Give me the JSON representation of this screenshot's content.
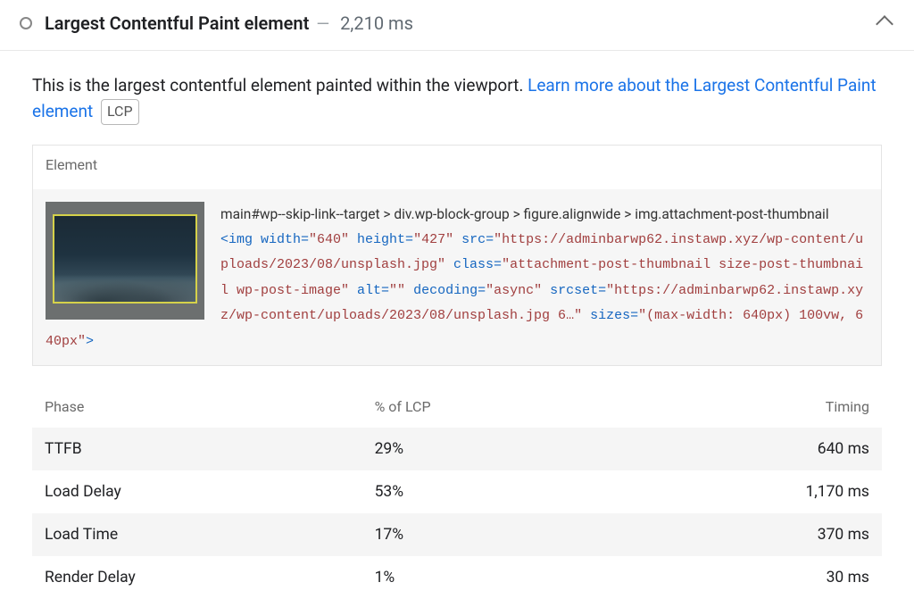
{
  "header": {
    "title": "Largest Contentful Paint element",
    "separator": "—",
    "timing": "2,210 ms"
  },
  "description": {
    "lead": "This is the largest contentful element painted within the viewport. ",
    "link_text": "Learn more about the Largest Contentful Paint element",
    "badge": "LCP"
  },
  "element_card": {
    "header": "Element",
    "selector_path": "main#wp--skip-link--target > div.wp-block-group > figure.alignwide > img.attachment-post-thumbnail",
    "html_snippet_prefix": "<img width=",
    "w": "\"640\"",
    "h_label": " height=",
    "h": "\"427\"",
    "src_label": " src=",
    "src": "\"https://adminbarwp62.instawp.xyz/wp-content/uploads/2023/08/unsplash.jpg\"",
    "class_label": " class=",
    "class": "\"attachment-post-thumbnail size-post-thumbnail wp-post-image\"",
    "alt_label": " alt=",
    "alt": "\"\"",
    "decoding_label": " decoding=",
    "decoding": "\"async\"",
    "srcset_label": " srcset=",
    "srcset": "\"https://adminbarwp62.instawp.xyz/wp-content/uploads/2023/08/unsplash.jpg 6…\"",
    "sizes_label": " sizes=",
    "sizes": "\"(max-width: 640px) 100vw, 640px\"",
    "close": ">"
  },
  "phase_table": {
    "head": {
      "phase": "Phase",
      "pct": "% of LCP",
      "timing": "Timing"
    },
    "rows": [
      {
        "phase": "TTFB",
        "pct": "29%",
        "timing": "640 ms"
      },
      {
        "phase": "Load Delay",
        "pct": "53%",
        "timing": "1,170 ms"
      },
      {
        "phase": "Load Time",
        "pct": "17%",
        "timing": "370 ms"
      },
      {
        "phase": "Render Delay",
        "pct": "1%",
        "timing": "30 ms"
      }
    ]
  }
}
